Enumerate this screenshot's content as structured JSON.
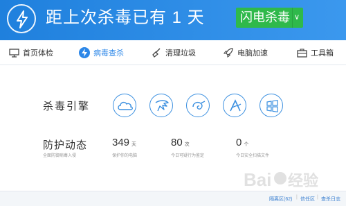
{
  "header": {
    "headline": "距上次杀毒已有 1 天",
    "kill_button": "闪电杀毒",
    "brand_color": "#2b89e6",
    "button_color": "#2fb94b"
  },
  "tabs": [
    {
      "label": "首页体检",
      "icon": "monitor-icon"
    },
    {
      "label": "病毒查杀",
      "icon": "shield-bolt-icon",
      "active": true
    },
    {
      "label": "清理垃圾",
      "icon": "broom-icon"
    },
    {
      "label": "电脑加速",
      "icon": "rocket-icon"
    },
    {
      "label": "工具箱",
      "icon": "toolbox-icon"
    }
  ],
  "engines": {
    "label": "杀毒引擎",
    "icons": [
      "cloud-engine-icon",
      "eagle-engine-icon",
      "spiral-engine-icon",
      "avira-engine-icon",
      "windows-engine-icon"
    ]
  },
  "protection": {
    "label": "防护动态",
    "sublabel": "全面防御病毒入侵",
    "stats": [
      {
        "value": "349",
        "unit": "天",
        "caption": "保护你的电脑"
      },
      {
        "value": "80",
        "unit": "次",
        "caption": "今日可疑行为鉴定"
      },
      {
        "value": "0",
        "unit": "个",
        "caption": "今日安全扫描文件"
      }
    ]
  },
  "footer": {
    "quarantine": "隔离区(62)",
    "trust": "信任区",
    "log": "查杀日志"
  },
  "watermark": "Baidu 经验"
}
